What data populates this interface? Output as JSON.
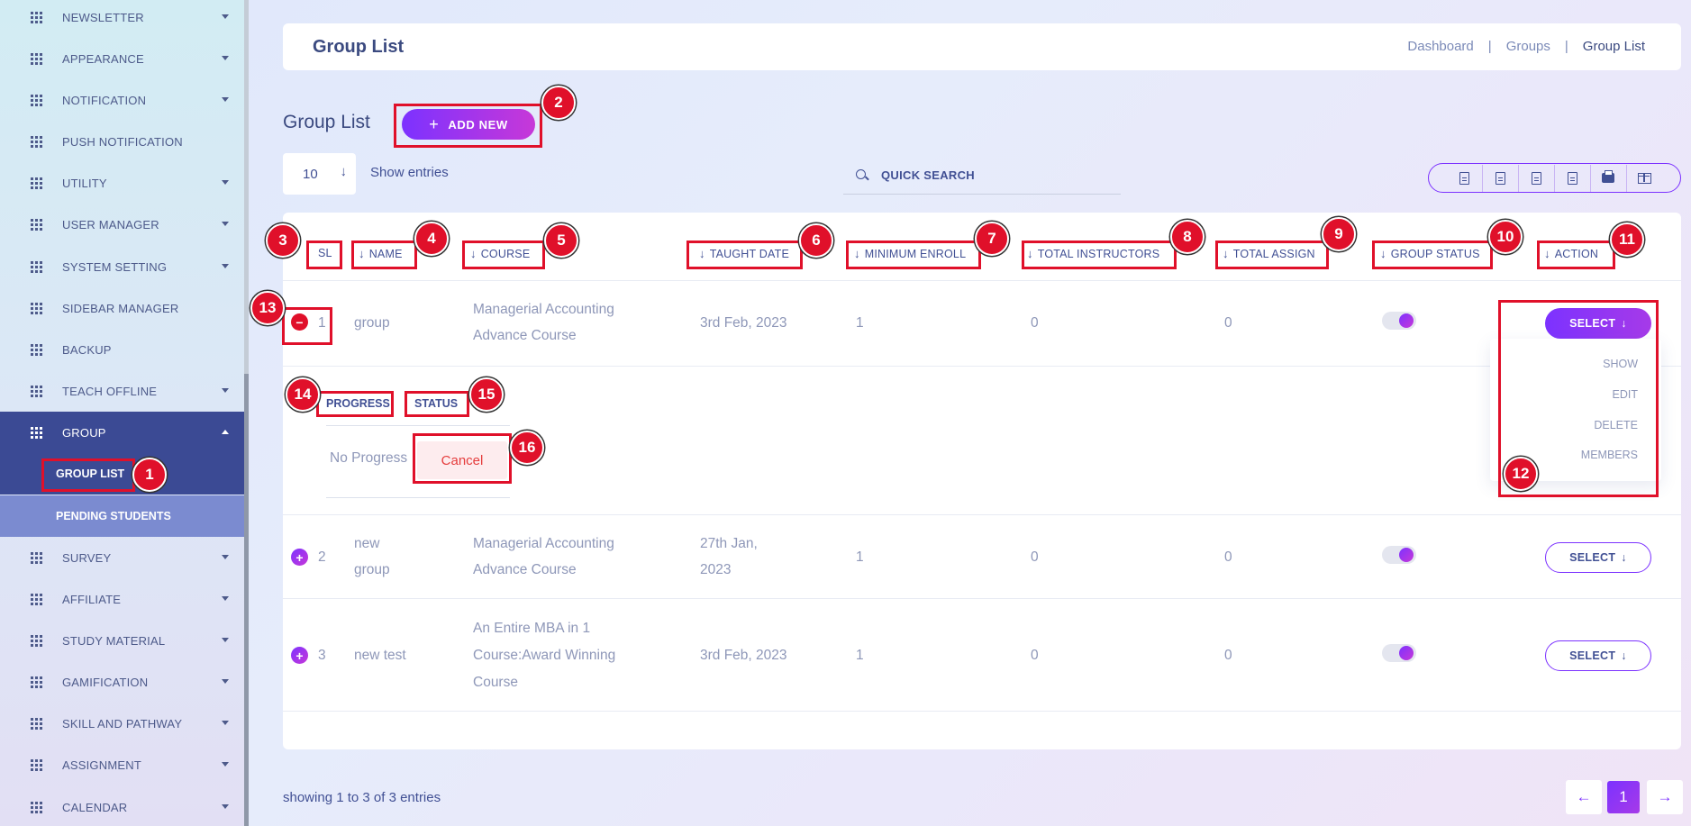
{
  "sidebar": {
    "items": [
      {
        "label": "NEWSLETTER",
        "caret": true
      },
      {
        "label": "APPEARANCE",
        "caret": true
      },
      {
        "label": "NOTIFICATION",
        "caret": true
      },
      {
        "label": "PUSH NOTIFICATION",
        "caret": false
      },
      {
        "label": "UTILITY",
        "caret": true
      },
      {
        "label": "USER MANAGER",
        "caret": true
      },
      {
        "label": "SYSTEM SETTING",
        "caret": true
      },
      {
        "label": "SIDEBAR MANAGER",
        "caret": false
      },
      {
        "label": "BACKUP",
        "caret": false
      },
      {
        "label": "TEACH OFFLINE",
        "caret": true
      },
      {
        "label": "GROUP",
        "caret": true,
        "active": true
      },
      {
        "label": "SURVEY",
        "caret": true
      },
      {
        "label": "AFFILIATE",
        "caret": true
      },
      {
        "label": "STUDY MATERIAL",
        "caret": true
      },
      {
        "label": "GAMIFICATION",
        "caret": true
      },
      {
        "label": "SKILL AND PATHWAY",
        "caret": true
      },
      {
        "label": "ASSIGNMENT",
        "caret": true
      },
      {
        "label": "CALENDAR",
        "caret": true
      }
    ],
    "group_sub": {
      "group_list": "GROUP LIST",
      "pending_students": "PENDING STUDENTS"
    }
  },
  "header": {
    "title": "Group List",
    "breadcrumb": [
      "Dashboard",
      "|",
      "Groups",
      "|",
      "Group List"
    ]
  },
  "list": {
    "title": "Group List",
    "add_new": "ADD NEW",
    "entries_value": "10",
    "show_entries": "Show entries",
    "search_placeholder": "QUICK SEARCH"
  },
  "table": {
    "columns": [
      "SL",
      "NAME",
      "COURSE",
      "TAUGHT DATE",
      "MINIMUM ENROLL",
      "TOTAL INSTRUCTORS",
      "TOTAL ASSIGN",
      "GROUP STATUS",
      "ACTION"
    ],
    "rows": [
      {
        "sl": "1",
        "name": "group",
        "course": [
          "Managerial Accounting",
          "Advance Course"
        ],
        "date": [
          "3rd Feb, 2023"
        ],
        "min_enroll": "1",
        "instructors": "0",
        "assign": "0",
        "status_on": true,
        "action": "SELECT"
      },
      {
        "sl": "2",
        "name": [
          "new",
          "group"
        ],
        "course": [
          "Managerial Accounting",
          "Advance Course"
        ],
        "date": [
          "27th Jan,",
          "2023"
        ],
        "min_enroll": "1",
        "instructors": "0",
        "assign": "0",
        "status_on": true,
        "action": "SELECT"
      },
      {
        "sl": "3",
        "name": "new test",
        "course": [
          "An Entire MBA in 1",
          "Course:Award Winning",
          "Course"
        ],
        "date": [
          "3rd Feb, 2023"
        ],
        "min_enroll": "1",
        "instructors": "0",
        "assign": "0",
        "status_on": true,
        "action": "SELECT"
      }
    ],
    "child_row": {
      "progress_label": "PROGRESS",
      "status_label": "STATUS",
      "progress_value": "No Progress",
      "cancel": "Cancel"
    },
    "dropdown": [
      "SHOW",
      "EDIT",
      "DELETE",
      "MEMBERS"
    ]
  },
  "footer": {
    "showing": "showing 1 to 3 of 3 entries",
    "prev": "←",
    "page": "1",
    "next": "→"
  },
  "annotations": [
    "1",
    "2",
    "3",
    "4",
    "5",
    "6",
    "7",
    "8",
    "9",
    "10",
    "11",
    "12",
    "13",
    "14",
    "15",
    "16"
  ],
  "colors": {
    "accent": "#7c32ff",
    "accent_end": "#c738d8",
    "sidebar_active": "#3b4a94",
    "text": "#415094",
    "annotation": "#e0102a"
  }
}
